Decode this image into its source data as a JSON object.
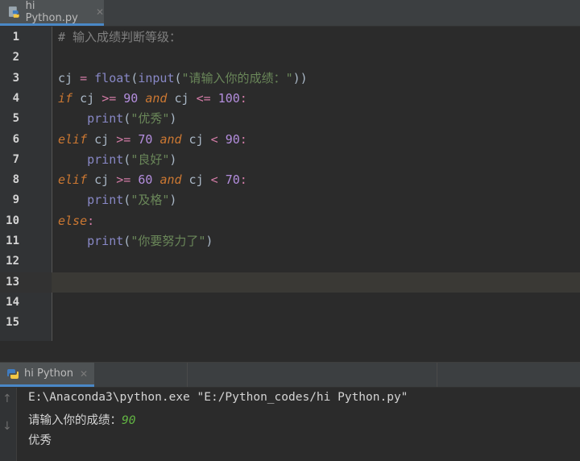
{
  "editor_tab": {
    "label": "hi Python.py",
    "close": "✕",
    "icon": "python-file-icon"
  },
  "lines": [
    {
      "n": "1",
      "tokens": [
        [
          "cmt",
          "# 输入成绩判断等级："
        ]
      ]
    },
    {
      "n": "2",
      "tokens": []
    },
    {
      "n": "3",
      "tokens": [
        [
          "pl",
          "cj "
        ],
        [
          "op",
          "="
        ],
        [
          "pl",
          " "
        ],
        [
          "bi",
          "float"
        ],
        [
          "pl",
          "("
        ],
        [
          "bi",
          "input"
        ],
        [
          "pl",
          "("
        ],
        [
          "str",
          "\"请输入你的成绩：\""
        ],
        [
          "pl",
          "))"
        ]
      ]
    },
    {
      "n": "4",
      "tokens": [
        [
          "kw",
          "if"
        ],
        [
          "pl",
          " cj "
        ],
        [
          "op",
          ">="
        ],
        [
          "pl",
          " "
        ],
        [
          "num",
          "90"
        ],
        [
          "pl",
          " "
        ],
        [
          "kw",
          "and"
        ],
        [
          "pl",
          " cj "
        ],
        [
          "op",
          "<="
        ],
        [
          "pl",
          " "
        ],
        [
          "num",
          "100"
        ],
        [
          "op",
          ":"
        ]
      ]
    },
    {
      "n": "5",
      "tokens": [
        [
          "pl",
          "    "
        ],
        [
          "bi",
          "print"
        ],
        [
          "pl",
          "("
        ],
        [
          "str",
          "\"优秀\""
        ],
        [
          "pl",
          ")"
        ]
      ]
    },
    {
      "n": "6",
      "tokens": [
        [
          "kw",
          "elif"
        ],
        [
          "pl",
          " cj "
        ],
        [
          "op",
          ">="
        ],
        [
          "pl",
          " "
        ],
        [
          "num",
          "70"
        ],
        [
          "pl",
          " "
        ],
        [
          "kw",
          "and"
        ],
        [
          "pl",
          " cj "
        ],
        [
          "op",
          "<"
        ],
        [
          "pl",
          " "
        ],
        [
          "num",
          "90"
        ],
        [
          "op",
          ":"
        ]
      ]
    },
    {
      "n": "7",
      "tokens": [
        [
          "pl",
          "    "
        ],
        [
          "bi",
          "print"
        ],
        [
          "pl",
          "("
        ],
        [
          "str",
          "\"良好\""
        ],
        [
          "pl",
          ")"
        ]
      ]
    },
    {
      "n": "8",
      "tokens": [
        [
          "kw",
          "elif"
        ],
        [
          "pl",
          " cj "
        ],
        [
          "op",
          ">="
        ],
        [
          "pl",
          " "
        ],
        [
          "num",
          "60"
        ],
        [
          "pl",
          " "
        ],
        [
          "kw",
          "and"
        ],
        [
          "pl",
          " cj "
        ],
        [
          "op",
          "<"
        ],
        [
          "pl",
          " "
        ],
        [
          "num",
          "70"
        ],
        [
          "op",
          ":"
        ]
      ]
    },
    {
      "n": "9",
      "tokens": [
        [
          "pl",
          "    "
        ],
        [
          "bi",
          "print"
        ],
        [
          "pl",
          "("
        ],
        [
          "str",
          "\"及格\""
        ],
        [
          "pl",
          ")"
        ]
      ]
    },
    {
      "n": "10",
      "tokens": [
        [
          "kw",
          "else"
        ],
        [
          "op",
          ":"
        ]
      ]
    },
    {
      "n": "11",
      "tokens": [
        [
          "pl",
          "    "
        ],
        [
          "bi",
          "print"
        ],
        [
          "pl",
          "("
        ],
        [
          "str",
          "\"你要努力了\""
        ],
        [
          "pl",
          ")"
        ]
      ]
    },
    {
      "n": "12",
      "tokens": []
    },
    {
      "n": "13",
      "tokens": [],
      "current": true
    },
    {
      "n": "14",
      "tokens": []
    },
    {
      "n": "15",
      "tokens": []
    }
  ],
  "run_tab": {
    "label": "hi Python",
    "close": "✕",
    "icon": "python-run-icon"
  },
  "console": {
    "command": "E:\\Anaconda3\\python.exe \"E:/Python_codes/hi Python.py\"",
    "prompt": "请输入你的成绩：",
    "input": "90",
    "output": "优秀",
    "up_arrow": "↑",
    "down_arrow": "↓"
  }
}
